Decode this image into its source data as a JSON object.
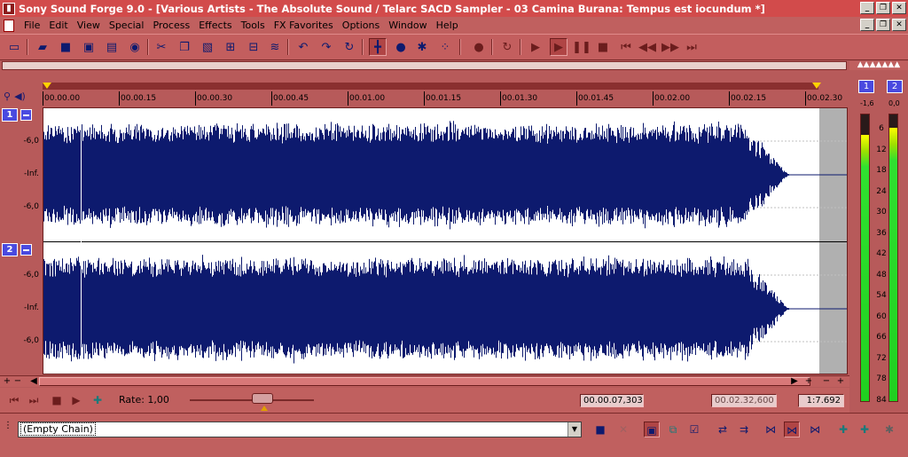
{
  "window": {
    "title": "Sony Sound Forge 9.0 - [Various Artists - The Absolute Sound / Telarc SACD Sampler - 03 Camina Burana: Tempus est iocundum *]",
    "app_icon": "sf-icon",
    "minimize": "_",
    "maximize": "❐",
    "close": "✕"
  },
  "menu": {
    "items": [
      "File",
      "Edit",
      "View",
      "Special",
      "Process",
      "Effects",
      "Tools",
      "FX Favorites",
      "Options",
      "Window",
      "Help"
    ]
  },
  "toolbar": {
    "icons": [
      "new-icon",
      "open-icon",
      "save-icon",
      "save-as-icon",
      "render-icon",
      "properties-icon",
      "cut-icon",
      "copy-icon",
      "paste-icon",
      "mix-icon",
      "trim-icon",
      "undo-icon",
      "redo-icon",
      "repeat-icon",
      "edit-tool-icon",
      "magnify-tool-icon",
      "pencil-tool-icon",
      "envelope-tool-icon",
      "record-icon",
      "loop-icon",
      "play-all-icon",
      "play-icon",
      "pause-icon",
      "stop-icon",
      "go-start-icon",
      "rewind-icon",
      "forward-icon",
      "go-end-icon"
    ]
  },
  "ruler": {
    "labels": [
      "00.00.00",
      "00.00.15",
      "00.00.30",
      "00.00.45",
      "00.01.00",
      "00.01.15",
      "00.01.30",
      "00.01.45",
      "00.02.00",
      "00.02.15",
      "00.02.30"
    ]
  },
  "channels": [
    {
      "number": "1",
      "db_labels": [
        "-6,0",
        "-Inf.",
        "-6,0"
      ]
    },
    {
      "number": "2",
      "db_labels": [
        "-6,0",
        "-Inf.",
        "-6,0"
      ]
    }
  ],
  "waveform_color": "#0d1a6e",
  "transport": {
    "rate_label": "Rate: 1,00",
    "rate_value": 1.0,
    "cursor_position": "00.00.07,303",
    "total_length": "00.02.32,600",
    "zoom_ratio": "1:7.692"
  },
  "meters": {
    "header": "▲▲▲▲▲▲▲",
    "channels": [
      {
        "number": "1",
        "peak": "-1,6",
        "level_fraction": 0.93
      },
      {
        "number": "2",
        "peak": "0,0",
        "level_fraction": 0.955
      }
    ],
    "scale": [
      "6",
      "12",
      "18",
      "24",
      "30",
      "36",
      "42",
      "48",
      "54",
      "60",
      "66",
      "72",
      "78",
      "84"
    ]
  },
  "plugin_chain": {
    "value": "(Empty Chain)"
  }
}
